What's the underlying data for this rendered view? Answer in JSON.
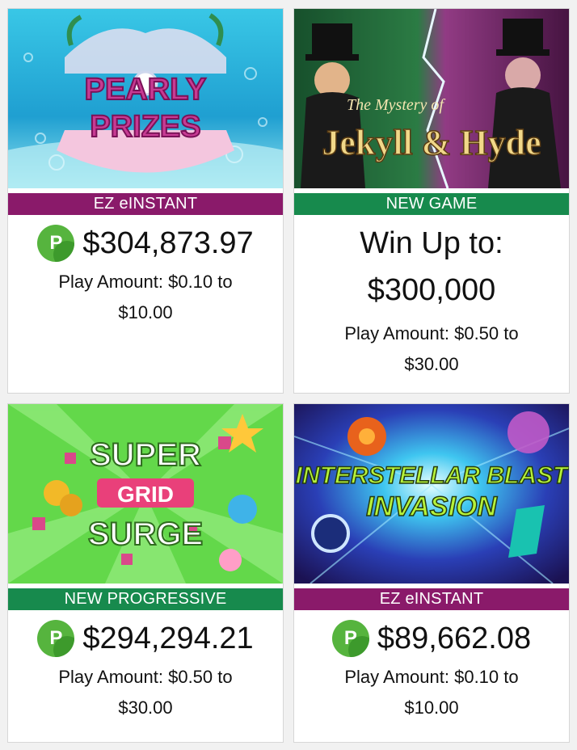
{
  "games": [
    {
      "title_line1": "PEARLY",
      "title_line2": "PRIZES",
      "badge": "EZ eINSTANT",
      "jackpot_icon": "P",
      "jackpot": "$304,873.97",
      "play_line1": "Play Amount: $0.10 to",
      "play_line2": "$10.00"
    },
    {
      "title_small": "The Mystery of",
      "title_large": "Jekyll & Hyde",
      "badge": "NEW GAME",
      "win_line1": "Win Up to:",
      "win_line2": "$300,000",
      "play_line1": "Play Amount: $0.50 to",
      "play_line2": "$30.00"
    },
    {
      "title_line1": "SUPER",
      "title_line2": "GRID",
      "title_line3": "SURGE",
      "badge": "NEW PROGRESSIVE",
      "jackpot_icon": "P",
      "jackpot": "$294,294.21",
      "play_line1": "Play Amount: $0.50 to",
      "play_line2": "$30.00"
    },
    {
      "title_line1": "INTERSTELLAR BLAST",
      "title_line2": "INVASION",
      "badge": "EZ eINSTANT",
      "jackpot_icon": "P",
      "jackpot": "$89,662.08",
      "play_line1": "Play Amount: $0.10 to",
      "play_line2": "$10.00"
    }
  ],
  "colors": {
    "einstant": "#8a1a6a",
    "new": "#178a4d",
    "progressive_icon": "#56b43e"
  }
}
